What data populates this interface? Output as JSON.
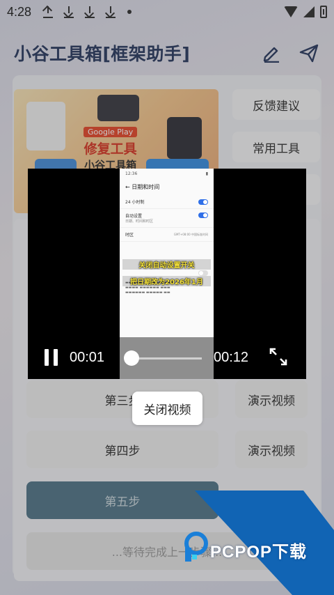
{
  "status_bar": {
    "time": "4:28"
  },
  "header": {
    "title": "小谷工具箱[框架助手]"
  },
  "banner": {
    "line1": "Google Play",
    "line2": "修复工具",
    "line3": "小谷工具箱"
  },
  "side_buttons": {
    "feedback": "反馈建议",
    "tools": "常用工具"
  },
  "steps": {
    "step3": "第三步",
    "step4": "第四步",
    "step5": "第五步",
    "demo": "演示视频",
    "waiting": "...等待完成上一步骤..."
  },
  "video": {
    "current_time": "00:01",
    "total_time": "00:12",
    "progress": 0.08,
    "frame": {
      "clock": "12:36",
      "title": "日期和时间",
      "row_24h": "24 小时制",
      "row_auto": "自动设置",
      "row_auto_sub": "日期、时间和时区",
      "row_tz": "时区",
      "row_tz_value": "GMT+08:00 中国标准时间",
      "caption1": "关闭自动设置开关",
      "caption2": "把日期改为2026年1月"
    },
    "close_label": "关闭视频"
  },
  "watermark": {
    "text": "PCPOP下载"
  },
  "colors": {
    "title": "#2c3c62",
    "step5_bg": "#54778a",
    "toggle_on": "#2f6fe8",
    "watermark": "#1164b4"
  }
}
